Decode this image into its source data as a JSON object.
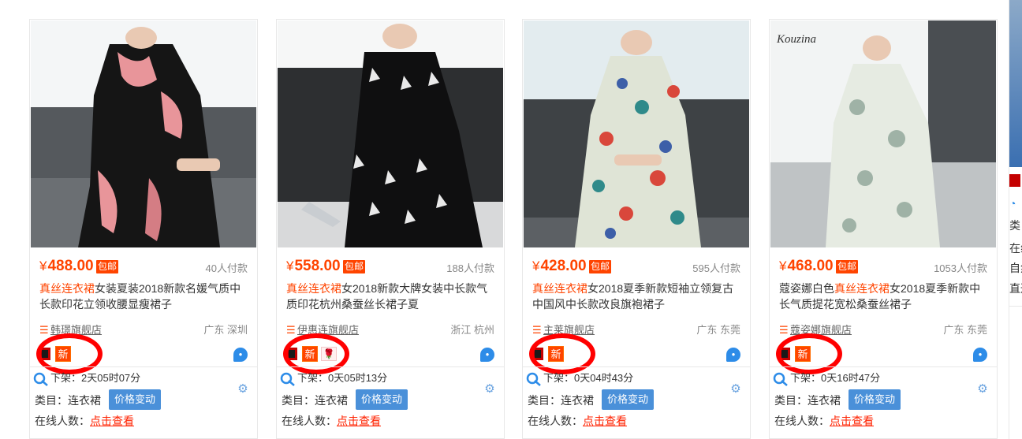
{
  "products": [
    {
      "price_currency": "¥",
      "price": "488.00",
      "free_shipping": "包邮",
      "sold": "40人付款",
      "title_keyword": "真丝连衣裙",
      "title_rest": "女装夏装2018新款名媛气质中长款印花立领收腰显瘦裙子",
      "title_prefix": "",
      "shop": "韩璟旗舰店",
      "location": "广东 深圳",
      "new_label": "新",
      "show_rose": false,
      "shelf_text": "下架：2天05时07分",
      "category": "类目：连衣裙",
      "price_change": "价格变动",
      "online_label": "在线人数：",
      "online_link": "点击查看"
    },
    {
      "price_currency": "¥",
      "price": "558.00",
      "free_shipping": "包邮",
      "sold": "188人付款",
      "title_keyword": "真丝连衣裙",
      "title_rest": "女2018新款大牌女装中长款气质印花杭州桑蚕丝长裙子夏",
      "title_prefix": "",
      "shop": "伊惠连旗舰店",
      "location": "浙江 杭州",
      "new_label": "新",
      "show_rose": true,
      "rose": "🌹",
      "shelf_text": "下架：0天05时13分",
      "category": "类目：连衣裙",
      "price_change": "价格变动",
      "online_label": "在线人数：",
      "online_link": "点击查看"
    },
    {
      "price_currency": "¥",
      "price": "428.00",
      "free_shipping": "包邮",
      "sold": "595人付款",
      "title_keyword": "真丝连衣裙",
      "title_rest": "女2018夏季新款短袖立领复古中国风中长款改良旗袍裙子",
      "title_prefix": "",
      "shop": "主莱旗舰店",
      "location": "广东 东莞",
      "new_label": "新",
      "show_rose": false,
      "shelf_text": "下架：0天04时43分",
      "category": "类目：连衣裙",
      "price_change": "价格变动",
      "online_label": "在线人数：",
      "online_link": "点击查看"
    },
    {
      "price_currency": "¥",
      "price": "468.00",
      "free_shipping": "包邮",
      "sold": "1053人付款",
      "title_prefix": "蔻姿娜白色",
      "title_keyword": "真丝连衣裙",
      "title_rest": "女2018夏季新款中长气质提花宽松桑蚕丝裙子",
      "shop": "蔻姿娜旗舰店",
      "location": "广东 东莞",
      "new_label": "新",
      "show_rose": false,
      "shelf_text": "下架：0天16时47分",
      "category": "类目：连衣裙",
      "price_change": "价格变动",
      "online_label": "在线人数：",
      "online_link": "点击查看",
      "brand_logo": "Kouzina"
    }
  ],
  "next_card": {
    "lines": [
      "类目",
      "在线",
      "自然",
      "直通"
    ]
  },
  "colors": {
    "accent": "#ff4400",
    "link_red": "#ff2200",
    "button_blue": "#4a90d9",
    "annotation_red": "#ff0000"
  }
}
